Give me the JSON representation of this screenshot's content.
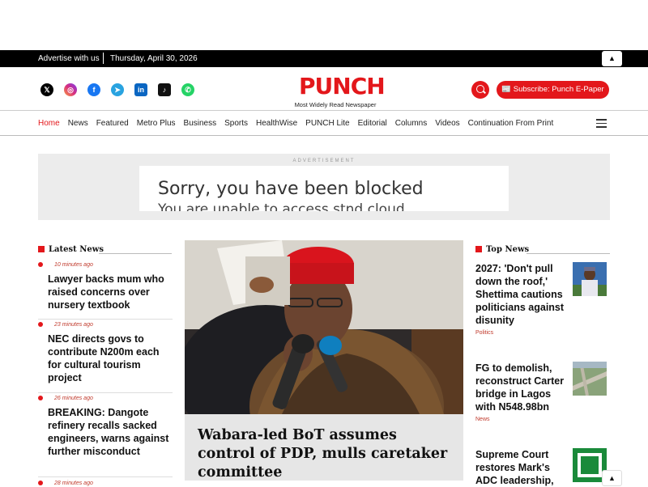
{
  "topbar": {
    "advertise": "Advertise with us",
    "date": "Thursday, April 30, 2026",
    "scroll_top": "▲"
  },
  "header": {
    "logo": "PUNCH",
    "tagline": "Most Widely Read Newspaper",
    "subscribe": "📰 Subscribe: Punch E-Paper",
    "social": [
      "x-icon",
      "instagram-icon",
      "facebook-icon",
      "telegram-icon",
      "linkedin-icon",
      "tiktok-icon",
      "whatsapp-icon"
    ]
  },
  "nav": {
    "items": [
      "Home",
      "News",
      "Featured",
      "Metro Plus",
      "Business",
      "Sports",
      "HealthWise",
      "PUNCH Lite",
      "Editorial",
      "Columns",
      "Videos",
      "Continuation From Print"
    ]
  },
  "ad": {
    "label": "ADVERTISEMENT",
    "line1": "Sorry, you have been blocked",
    "line2": "You are unable to access stnd.cloud"
  },
  "latest": {
    "heading": "Latest News",
    "items": [
      {
        "time": "10 minutes ago",
        "title": "Lawyer backs mum who raised concerns over nursery textbook"
      },
      {
        "time": "23 minutes ago",
        "title": "NEC directs govs to contribute N200m each for cultural tourism project"
      },
      {
        "time": "26 minutes ago",
        "title": "BREAKING: Dangote refinery recalls sacked engineers, warns against further misconduct"
      },
      {
        "time": "28 minutes ago",
        "title": ""
      }
    ]
  },
  "feature": {
    "title": "Wabara-led BoT assumes control of PDP, mulls caretaker committee"
  },
  "top_news": {
    "heading": "Top News",
    "items": [
      {
        "title": "2027: 'Don't pull down the roof,' Shettima cautions politicians against disunity",
        "category": "Politics"
      },
      {
        "title": "FG to demolish, reconstruct Carter bridge in Lagos with N548.98bn",
        "category": "News"
      },
      {
        "title": "Supreme Court restores Mark's ADC leadership,",
        "category": ""
      }
    ]
  },
  "colors": {
    "brand": "#e3171b"
  }
}
